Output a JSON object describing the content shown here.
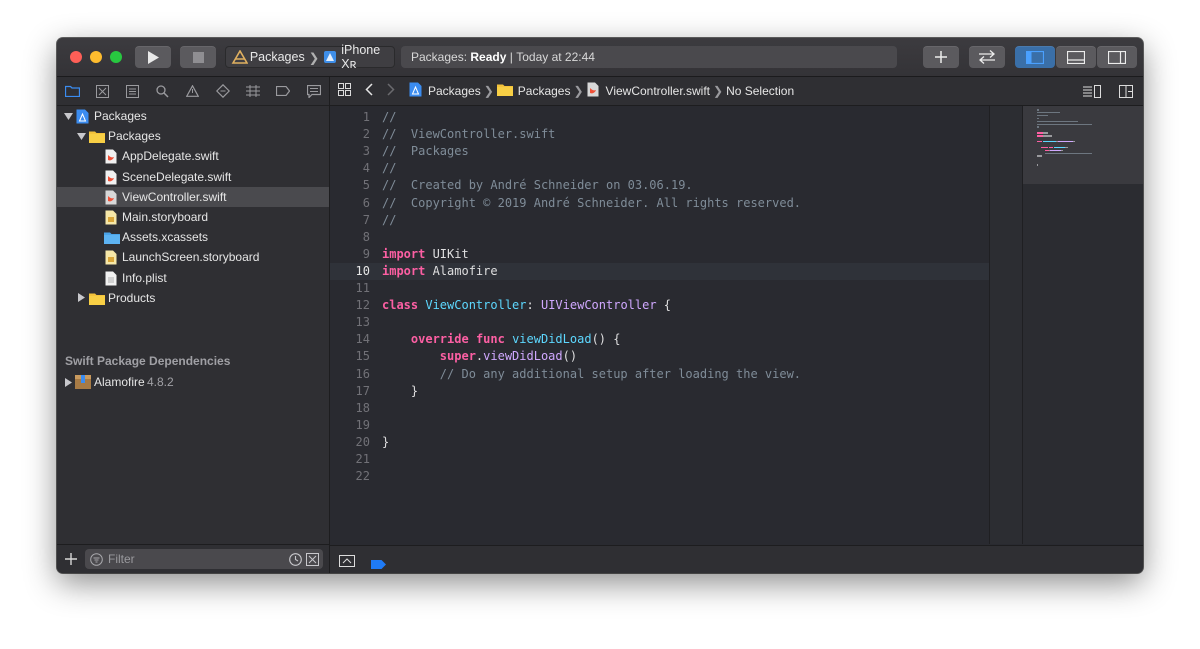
{
  "window": {
    "traffic_lights": {
      "close": "#fe5f57",
      "minimize": "#febc2e",
      "zoom": "#28c840"
    },
    "scheme": {
      "project": "Packages",
      "device": "iPhone Xʀ"
    },
    "activity": {
      "project": "Packages:",
      "status": "Ready",
      "separator": "|",
      "time": "Today at 22:44"
    }
  },
  "navigator": {
    "tabs": [
      "folder-icon",
      "source-control-icon",
      "symbol-icon",
      "find-icon",
      "issue-icon",
      "test-icon",
      "debug-icon",
      "breakpoint-icon",
      "report-icon"
    ],
    "tree": [
      {
        "label": "Packages",
        "level": 0,
        "icon": "project-icon",
        "open": true
      },
      {
        "label": "Packages",
        "level": 1,
        "icon": "folder-icon",
        "open": true
      },
      {
        "label": "AppDelegate.swift",
        "level": 2,
        "icon": "swift-file-icon"
      },
      {
        "label": "SceneDelegate.swift",
        "level": 2,
        "icon": "swift-file-icon"
      },
      {
        "label": "ViewController.swift",
        "level": 2,
        "icon": "swift-file-icon",
        "selected": true
      },
      {
        "label": "Main.storyboard",
        "level": 2,
        "icon": "storyboard-icon"
      },
      {
        "label": "Assets.xcassets",
        "level": 2,
        "icon": "assets-folder-icon"
      },
      {
        "label": "LaunchScreen.storyboard",
        "level": 2,
        "icon": "storyboard-icon"
      },
      {
        "label": "Info.plist",
        "level": 2,
        "icon": "plist-icon"
      },
      {
        "label": "Products",
        "level": 1,
        "icon": "folder-icon",
        "open": false
      }
    ],
    "dependencies_header": "Swift Package Dependencies",
    "dependency": {
      "name": "Alamofire",
      "version": "4.8.2"
    },
    "filter_placeholder": "Filter"
  },
  "jumpbar": {
    "crumbs": [
      "Packages",
      "Packages",
      "ViewController.swift",
      "No Selection"
    ]
  },
  "editor": {
    "current_line": 10,
    "lines": [
      [
        {
          "t": "c",
          "s": "//"
        }
      ],
      [
        {
          "t": "c",
          "s": "//  ViewController.swift"
        }
      ],
      [
        {
          "t": "c",
          "s": "//  Packages"
        }
      ],
      [
        {
          "t": "c",
          "s": "//"
        }
      ],
      [
        {
          "t": "c",
          "s": "//  Created by André Schneider on 03.06.19."
        }
      ],
      [
        {
          "t": "c",
          "s": "//  Copyright © 2019 André Schneider. All rights reserved."
        }
      ],
      [
        {
          "t": "c",
          "s": "//"
        }
      ],
      [],
      [
        {
          "t": "k",
          "s": "import"
        },
        {
          "t": "p",
          "s": " UIKit"
        }
      ],
      [
        {
          "t": "k",
          "s": "import"
        },
        {
          "t": "p",
          "s": " Alamofire"
        }
      ],
      [],
      [
        {
          "t": "k",
          "s": "class"
        },
        {
          "t": "p",
          "s": " "
        },
        {
          "t": "y",
          "s": "ViewController"
        },
        {
          "t": "p",
          "s": ": "
        },
        {
          "t": "l",
          "s": "UIViewController"
        },
        {
          "t": "p",
          "s": " {"
        }
      ],
      [],
      [
        {
          "t": "p",
          "s": "    "
        },
        {
          "t": "k",
          "s": "override"
        },
        {
          "t": "p",
          "s": " "
        },
        {
          "t": "k",
          "s": "func"
        },
        {
          "t": "p",
          "s": " "
        },
        {
          "t": "y",
          "s": "viewDidLoad"
        },
        {
          "t": "p",
          "s": "() {"
        }
      ],
      [
        {
          "t": "p",
          "s": "        "
        },
        {
          "t": "k",
          "s": "super"
        },
        {
          "t": "p",
          "s": "."
        },
        {
          "t": "l",
          "s": "viewDidLoad"
        },
        {
          "t": "p",
          "s": "()"
        }
      ],
      [
        {
          "t": "p",
          "s": "        "
        },
        {
          "t": "c",
          "s": "// Do any additional setup after loading the view."
        }
      ],
      [
        {
          "t": "p",
          "s": "    }"
        }
      ],
      [],
      [],
      [
        {
          "t": "p",
          "s": "}"
        }
      ],
      [],
      []
    ]
  },
  "colors": {
    "keyword": "#fc5fa3",
    "type_decl": "#5dd8ff",
    "library": "#d0a8ff",
    "comment": "#7f8c98",
    "accent": "#1f7bf6"
  }
}
